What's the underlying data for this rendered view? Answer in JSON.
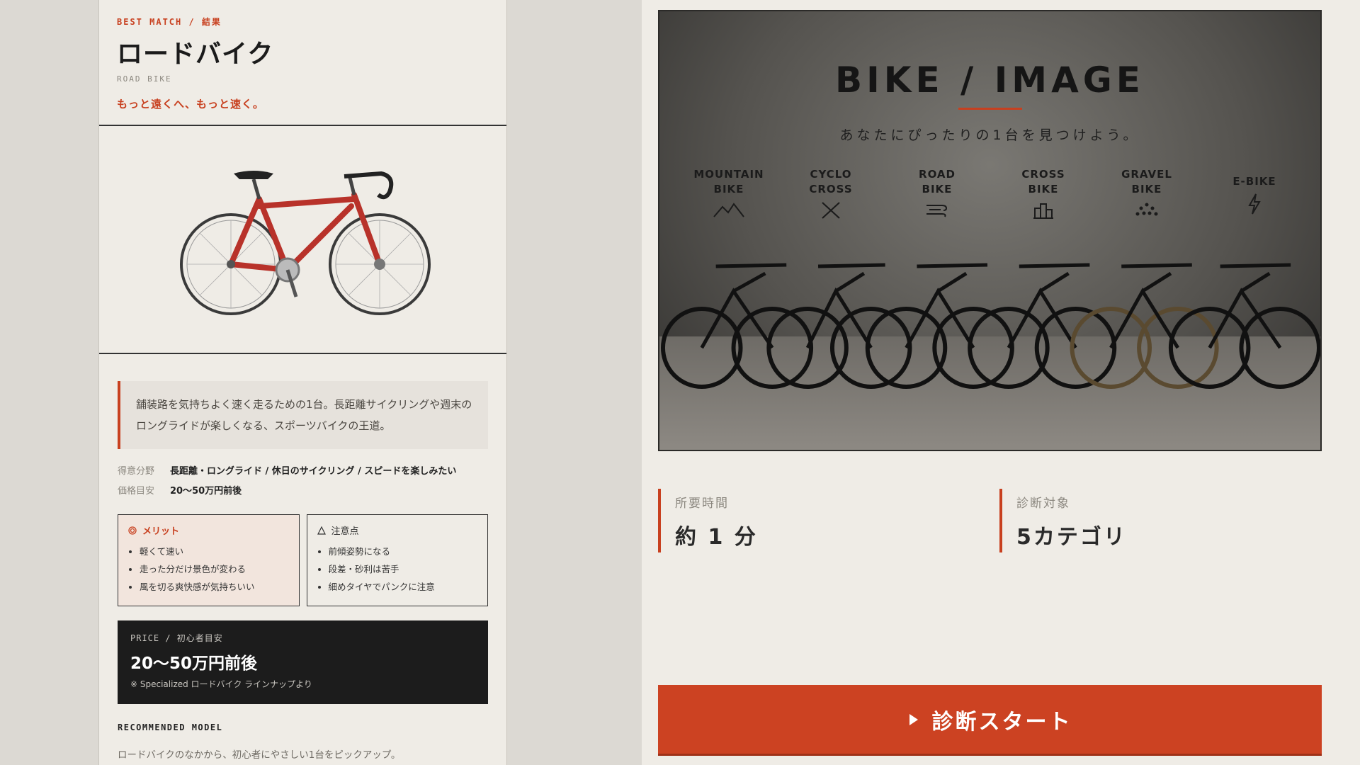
{
  "result": {
    "kicker": "BEST MATCH / 結果",
    "name": "ロードバイク",
    "name_en": "ROAD BIKE",
    "tagline": "もっと遠くへ、もっと速く。",
    "description": "舗装路を気持ちよく速く走るための1台。長距離サイクリングや週末のロングライドが楽しくなる、スポーツバイクの王道。",
    "meta": [
      {
        "key": "得意分野",
        "value": "長距離・ロングライド / 休日のサイクリング / スピードを楽しみたい"
      },
      {
        "key": "価格目安",
        "value": "20〜50万円前後"
      }
    ],
    "pros": {
      "icon": "double-circle-icon",
      "title": "メリット",
      "items": [
        "軽くて速い",
        "走った分だけ景色が変わる",
        "風を切る爽快感が気持ちいい"
      ]
    },
    "cons": {
      "icon": "triangle-icon",
      "title": "注意点",
      "items": [
        "前傾姿勢になる",
        "段差・砂利は苦手",
        "細めタイヤでパンクに注意"
      ]
    },
    "price": {
      "kicker": "PRICE / 初心者目安",
      "value": "20〜50万円前後",
      "note": "※ Specialized ロードバイク ラインナップより"
    },
    "recommended": {
      "label": "RECOMMENDED MODEL",
      "text": "ロードバイクのなかから、初心者にやさしい1台をピックアップ。"
    }
  },
  "hero": {
    "title": "BIKE / IMAGE",
    "subtitle": "あなたにぴったりの1台を見つけよう。",
    "categories": [
      {
        "line1": "MOUNTAIN",
        "line2": "BIKE",
        "icon": "mountain-icon"
      },
      {
        "line1": "CYCLO",
        "line2": "CROSS",
        "icon": "cross-icon"
      },
      {
        "line1": "ROAD",
        "line2": "BIKE",
        "icon": "wind-icon"
      },
      {
        "line1": "CROSS",
        "line2": "BIKE",
        "icon": "buildings-icon"
      },
      {
        "line1": "GRAVEL",
        "line2": "BIKE",
        "icon": "gravel-icon"
      },
      {
        "line1": "E-BIKE",
        "line2": "",
        "icon": "lightning-icon"
      }
    ]
  },
  "stats": [
    {
      "key": "所要時間",
      "value": "約 1 分"
    },
    {
      "key": "診断対象",
      "value": "5カテゴリ"
    }
  ],
  "cta": {
    "label": "診断スタート",
    "icon": "play-icon"
  },
  "colors": {
    "accent": "#c8401f",
    "cta": "#cc4222",
    "dark": "#1c1c1c",
    "panel": "#efece6"
  }
}
